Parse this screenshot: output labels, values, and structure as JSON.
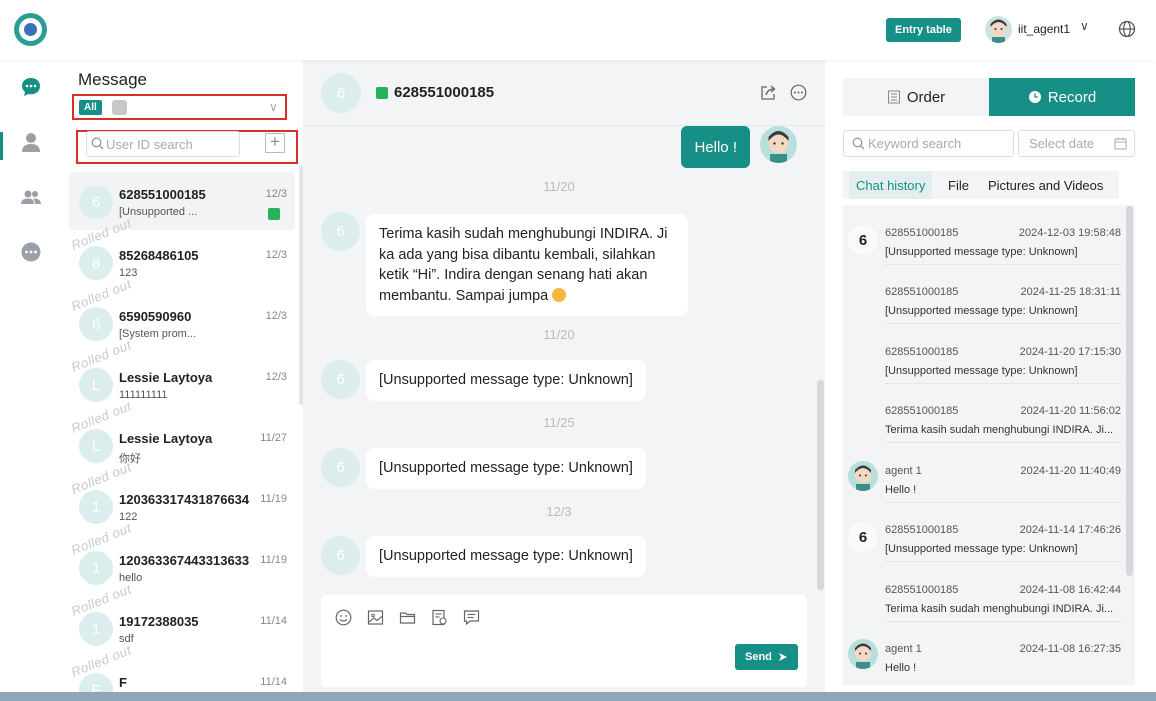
{
  "header": {
    "entry_table_label": "Entry table",
    "agent_name": "iit_agent1"
  },
  "list": {
    "title": "Message",
    "filter_all": "All",
    "search_placeholder": "User ID search",
    "add_label": "+",
    "rolled_label": "Rolled out",
    "items": [
      {
        "avatar": "6",
        "name": "628551000185",
        "preview": "[Unsupported ...",
        "date": "12/3"
      },
      {
        "avatar": "8",
        "name": "85268486105",
        "preview": "123",
        "date": "12/3"
      },
      {
        "avatar": "6",
        "name": "6590590960",
        "preview": "[System prom...",
        "date": "12/3"
      },
      {
        "avatar": "L",
        "name": "Lessie Laytoya",
        "preview": "111111111",
        "date": "12/3"
      },
      {
        "avatar": "L",
        "name": "Lessie Laytoya",
        "preview": "你好",
        "date": "11/27"
      },
      {
        "avatar": "1",
        "name": "120363317431876634",
        "preview": "122",
        "date": "11/19"
      },
      {
        "avatar": "1",
        "name": "120363367443313633",
        "preview": "hello",
        "date": "11/19"
      },
      {
        "avatar": "1",
        "name": "19172388035",
        "preview": "sdf",
        "date": "11/14"
      },
      {
        "avatar": "F",
        "name": "F",
        "preview": "",
        "date": "11/14"
      }
    ]
  },
  "chat": {
    "avatar": "6",
    "name": "628551000185",
    "out_message": "Hello !",
    "dates": [
      "11/20",
      "11/20",
      "11/25",
      "12/3"
    ],
    "in_messages": [
      {
        "avatar": "6",
        "lines": [
          "Terima kasih sudah menghubungi INDIRA. Ji",
          "ka ada yang bisa dibantu kembali, silahkan",
          "ketik “Hi”. Indira dengan senang hati akan",
          "membantu. Sampai jumpa"
        ]
      },
      {
        "avatar": "6",
        "lines": [
          "[Unsupported message type: Unknown]"
        ]
      },
      {
        "avatar": "6",
        "lines": [
          "[Unsupported message type: Unknown]"
        ]
      },
      {
        "avatar": "6",
        "lines": [
          "[Unsupported message type: Unknown]"
        ]
      }
    ],
    "send_label": "Send"
  },
  "right": {
    "tab_order": "Order",
    "tab_record": "Record",
    "keyword_placeholder": "Keyword search",
    "date_placeholder": "Select date",
    "subtabs": [
      "Chat history",
      "File",
      "Pictures and Videos"
    ],
    "history": [
      {
        "avatar": "6",
        "name": "628551000185",
        "time": "2024-12-03 19:58:48",
        "text": "[Unsupported message type: Unknown]"
      },
      {
        "avatar": "",
        "name": "628551000185",
        "time": "2024-11-25 18:31:11",
        "text": "[Unsupported message type: Unknown]"
      },
      {
        "avatar": "",
        "name": "628551000185",
        "time": "2024-11-20 17:15:30",
        "text": "[Unsupported message type: Unknown]"
      },
      {
        "avatar": "",
        "name": "628551000185",
        "time": "2024-11-20 11:56:02",
        "text": "Terima kasih sudah menghubungi INDIRA. Ji..."
      },
      {
        "avatar": "agent",
        "name": "agent 1",
        "time": "2024-11-20 11:40:49",
        "text": "Hello !"
      },
      {
        "avatar": "6",
        "name": "628551000185",
        "time": "2024-11-14 17:46:26",
        "text": "[Unsupported message type: Unknown]"
      },
      {
        "avatar": "",
        "name": "628551000185",
        "time": "2024-11-08 16:42:44",
        "text": "Terima kasih sudah menghubungi INDIRA. Ji..."
      },
      {
        "avatar": "agent",
        "name": "agent 1",
        "time": "2024-11-08 16:27:35",
        "text": "Hello !"
      }
    ]
  },
  "colors": {
    "accent": "#168f86",
    "whatsapp": "#25b35a",
    "highlight_box": "#d93025"
  },
  "icons": {
    "nav": [
      "chat-bubble-icon",
      "user-icon",
      "users-icon",
      "more-dots-icon"
    ],
    "composer": [
      "emoji-icon",
      "image-icon",
      "folder-icon",
      "document-icon",
      "quick-reply-icon"
    ]
  }
}
